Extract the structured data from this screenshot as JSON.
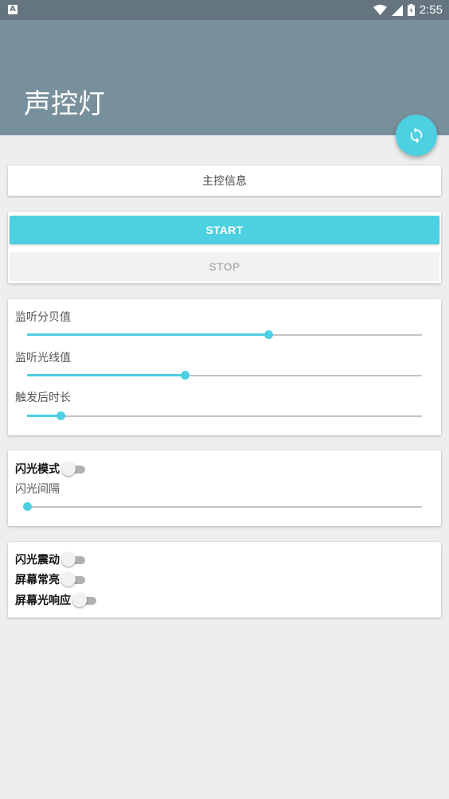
{
  "status_bar": {
    "time": "2:55",
    "notification_icon": "A"
  },
  "app_bar": {
    "title": "声控灯"
  },
  "fab": {
    "icon": "refresh-icon"
  },
  "info_card": {
    "text": "主控信息"
  },
  "buttons": {
    "start_label": "START",
    "stop_label": "STOP"
  },
  "sliders": [
    {
      "label": "监听分贝值",
      "value_fraction": 0.61
    },
    {
      "label": "监听光线值",
      "value_fraction": 0.4
    },
    {
      "label": "触发后时长",
      "value_fraction": 0.085
    }
  ],
  "flash": {
    "mode_label": "闪光模式",
    "mode_on": false,
    "interval_label": "闪光间隔",
    "interval_fraction": 0.0
  },
  "toggles": [
    {
      "label": "闪光震动",
      "on": false
    },
    {
      "label": "屏幕常亮",
      "on": false
    },
    {
      "label": "屏幕光响应",
      "on": false
    }
  ],
  "colors": {
    "accent": "#4dd0e1",
    "app_bar": "#78909c",
    "status_bar": "#64757f"
  }
}
